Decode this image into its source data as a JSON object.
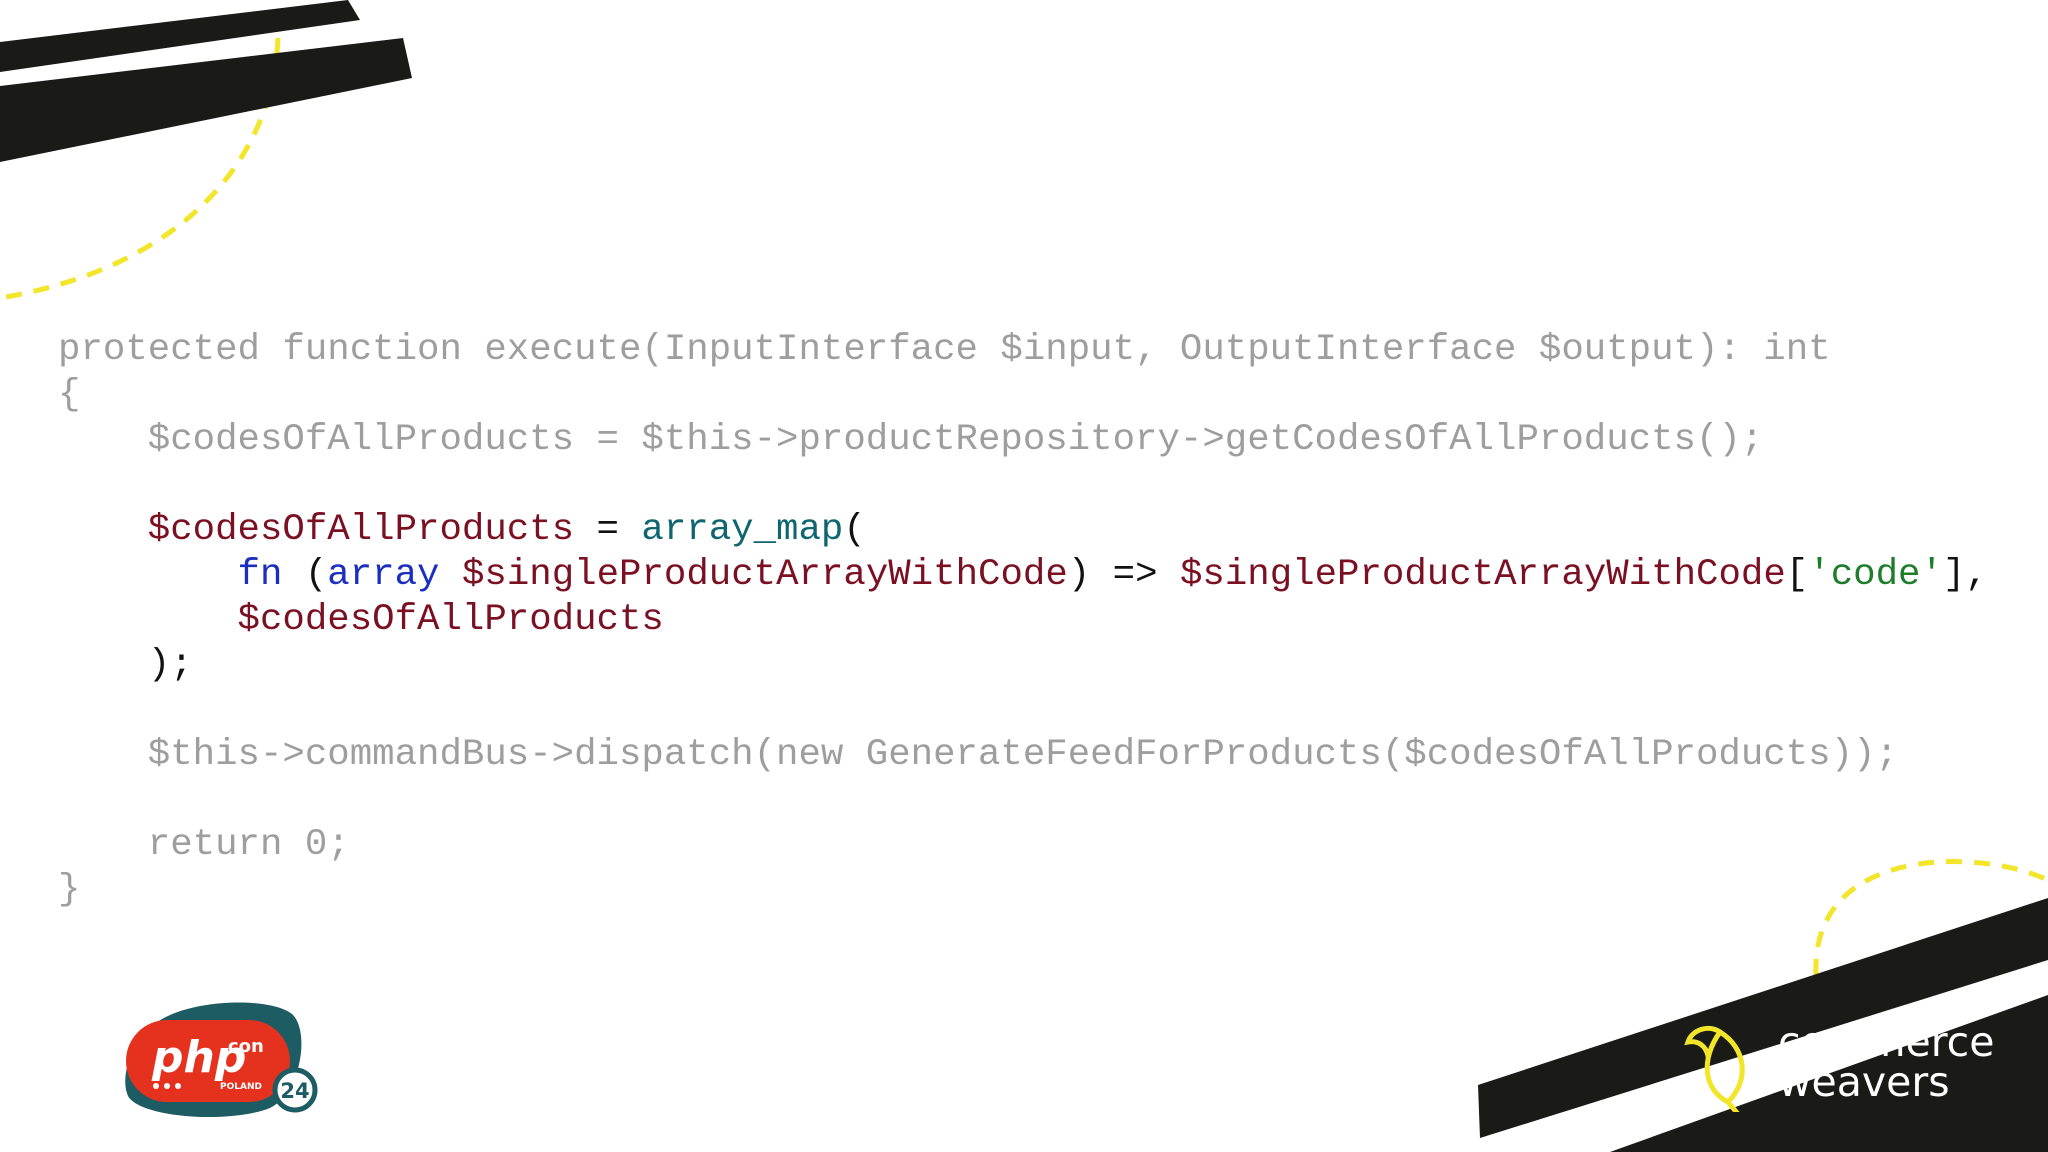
{
  "code": {
    "line1": "protected function execute(InputInterface $input, OutputInterface $output): int",
    "line2": "{",
    "line3": "    $codesOfAllProducts = $this->productRepository->getCodesOfAllProducts();",
    "line5_var": "    $codesOfAllProducts",
    "line5_eq": " = ",
    "line5_fn": "array_map",
    "line5_paren": "(",
    "line6_indent": "        ",
    "line6_fn": "fn",
    "line6_open": " (",
    "line6_type": "array",
    "line6_param": " $singleProductArrayWithCode",
    "line6_arrow": ") => ",
    "line6_var": "$singleProductArrayWithCode",
    "line6_open_bracket": "[",
    "line6_str": "'code'",
    "line6_close": "],",
    "line7_var": "        $codesOfAllProducts",
    "line8": "    );",
    "line10": "    $this->commandBus->dispatch(new GenerateFeedForProducts($codesOfAllProducts));",
    "line12": "    return 0;",
    "line13": "}"
  },
  "logos": {
    "phpcon_main": "php",
    "phpcon_sup": "con",
    "phpcon_country": "POLAND",
    "phpcon_year": "24",
    "brand_line1": "commerce",
    "brand_line2": "weavers"
  },
  "colors": {
    "dimmed_code": "#9e9e9e",
    "keyword": "#1a2fbf",
    "variable": "#7a1022",
    "function": "#0f6670",
    "string": "#1e7d2b",
    "stripe": "#1a1a16",
    "dash_accent": "#f2e52a",
    "phpcon_red": "#e5321e",
    "phpcon_teal": "#1d5c63"
  }
}
